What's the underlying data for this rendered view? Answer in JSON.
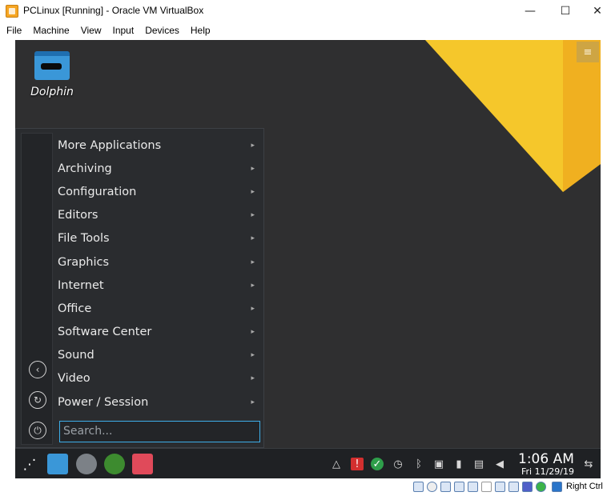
{
  "window": {
    "title": "PCLinux [Running] - Oracle VM VirtualBox",
    "minimize_glyph": "—",
    "maximize_glyph": "☐",
    "close_glyph": "✕"
  },
  "menubar": [
    "File",
    "Machine",
    "View",
    "Input",
    "Devices",
    "Help"
  ],
  "desktop": {
    "icon_label": "Dolphin",
    "wallpaper_accent": "#f5b821",
    "background": "#2f2f30"
  },
  "startmenu": {
    "items": [
      "More Applications",
      "Archiving",
      "Configuration",
      "Editors",
      "File Tools",
      "Graphics",
      "Internet",
      "Office",
      "Software Center",
      "Sound",
      "Video",
      "Power / Session"
    ],
    "submenu_glyph": "▸",
    "search_placeholder": "Search...",
    "side_icons": [
      "back-icon",
      "refresh-icon",
      "power-icon"
    ]
  },
  "taskbar": {
    "apps": [
      "dolphin-icon",
      "settings-icon",
      "xbox-icon",
      "install-icon"
    ],
    "tray": [
      "notification-icon",
      "alert-icon",
      "check-icon",
      "clock-icon",
      "bluetooth-icon",
      "network-icon",
      "usb-icon",
      "clipboard-icon",
      "volume-icon"
    ],
    "time": "1:06 AM",
    "date": "Fri 11/29/19"
  },
  "statusbar": {
    "host_key": "Right Ctrl"
  }
}
